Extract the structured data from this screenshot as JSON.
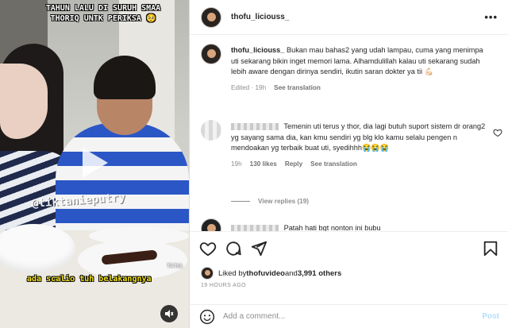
{
  "video": {
    "caption_top": "TAHUN LALU DI SURUH SMAA THORIQ UNTK PERIKSA 🥺",
    "watermark": "@tiktanieputry",
    "caption_bottom": "ada scalio tuh belakangnya",
    "tiktok_mark": "TikTok",
    "icons": {
      "play": "play-icon",
      "sound": "speaker-muted-icon"
    }
  },
  "post": {
    "username": "thofu_liciouss_",
    "more_label": "•••"
  },
  "comments": [
    {
      "username": "thofu_liciouss_",
      "text": "Bukan mau bahas2 yang udah lampau, cuma yang menimpa uti sekarang bikin inget memori lama. Alhamdulillah kalau uti sekarang sudah lebih aware dengan dirinya sendiri, ikutin saran dokter ya tii 💪🏻",
      "meta": {
        "edited": "Edited · 19h",
        "see_translation": "See translation"
      }
    },
    {
      "text": "Temenin uti terus y thor, dia lagi butuh suport sistem dr orang2 yg sayang sama dia, kan kmu sendiri yg blg klo kamu selalu pengen n mendoakan yg terbaik buat uti, syedihhh😭😭😭",
      "meta": {
        "time": "19h",
        "likes": "130 likes",
        "reply": "Reply",
        "see_translation": "See translation"
      },
      "view_replies": "View replies (19)"
    },
    {
      "partial_text": "Patah hati bgt nonton ini bubu"
    }
  ],
  "actions": {
    "icons": [
      "heart-icon",
      "comment-icon",
      "share-icon",
      "bookmark-icon"
    ],
    "liked_prefix": "Liked by ",
    "liked_user": "thofuvideo",
    "liked_and": " and ",
    "liked_count": "3,991 others",
    "timestamp": "19 HOURS AGO"
  },
  "add_comment": {
    "placeholder": "Add a comment...",
    "post_label": "Post"
  }
}
